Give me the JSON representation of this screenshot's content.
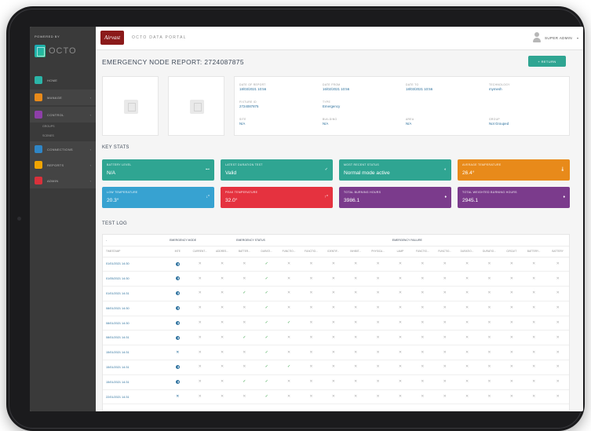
{
  "sidebar": {
    "powered_by": "POWERED BY",
    "logo_text": "OCTO",
    "items": [
      {
        "label": "HOME",
        "icon": "home-icon",
        "color": "#2bb5a8",
        "caret": ""
      },
      {
        "label": "MANAGE",
        "icon": "manage-icon",
        "color": "#e88a1a",
        "caret": "‹"
      },
      {
        "label": "CONTROL",
        "icon": "control-icon",
        "color": "#8e3fa8",
        "caret": "‹"
      },
      {
        "label": "CONNECTIONS",
        "icon": "connections-icon",
        "color": "#2f86c6",
        "caret": "‹"
      },
      {
        "label": "REPORTS",
        "icon": "reports-icon",
        "color": "#f0a400",
        "caret": "‹"
      },
      {
        "label": "ADMIN",
        "icon": "admin-icon",
        "color": "#d9313b",
        "caret": "‹"
      }
    ],
    "sub_items": [
      "GROUPS",
      "SCENES"
    ]
  },
  "topbar": {
    "logo_text": "Airvast",
    "portal_title": "OCTO DATA PORTAL",
    "user": "SUPER ADMIN",
    "caret": "▾"
  },
  "page": {
    "title": "EMERGENCY NODE REPORT: 2724087875",
    "return_label": "+ RETURN"
  },
  "info": {
    "date_of_report": {
      "label": "DATE OF REPORT",
      "value": "18/03/2021 10:56"
    },
    "date_from": {
      "label": "DATE FROM",
      "value": "16/02/2021 10:56"
    },
    "date_to": {
      "label": "DATE TO",
      "value": "18/03/2021 10:56"
    },
    "technology": {
      "label": "TECHNOLOGY",
      "value": "mymesh"
    },
    "fixture_id": {
      "label": "FIXTURE ID",
      "value": "2724087875"
    },
    "type": {
      "label": "TYPE",
      "value": "Emergency"
    },
    "site": {
      "label": "SITE",
      "value": "N/A"
    },
    "building": {
      "label": "BUILDING",
      "value": "N/A"
    },
    "area": {
      "label": "AREA",
      "value": "N/A"
    },
    "group": {
      "label": "GROUP",
      "value": "Not Grouped"
    }
  },
  "key_stats": {
    "title": "KEY STATS",
    "cards": [
      {
        "label": "BATTERY LEVEL",
        "value": "N/A",
        "color": "#2fa592",
        "icon": "⊷"
      },
      {
        "label": "LATEST DURATION TEST",
        "value": "Valid",
        "color": "#2fa592",
        "icon": "✓"
      },
      {
        "label": "MOST RECENT STATUS",
        "value": "Normal mode active",
        "color": "#2fa592",
        "icon": "◐"
      },
      {
        "label": "AVERAGE TEMPERATURE",
        "value": "26.4°",
        "color": "#e88a1a",
        "icon": "🌡"
      },
      {
        "label": "LOW TEMPERATURE",
        "value": "20.3°",
        "color": "#37a2d1",
        "icon": "↓°"
      },
      {
        "label": "PEAK TEMPERATURE",
        "value": "32.0°",
        "color": "#e5323f",
        "icon": "↑°"
      },
      {
        "label": "TOTAL BURNING HOURS",
        "value": "3986.1",
        "color": "#7b3b8c",
        "icon": "♦"
      },
      {
        "label": "TOTAL WEIGHTED BURNING HOURS",
        "value": "2945.1",
        "color": "#7b3b8c",
        "icon": "♦"
      }
    ]
  },
  "test_log": {
    "title": "TEST LOG",
    "groups": [
      "EMERGENCY MODE",
      "EMERGENCY STATUS",
      "EMERGENCY FAILURE"
    ],
    "columns": [
      "TIMESTAMP",
      "INTE",
      "CURRENT...",
      "ADDRES...",
      "BATTER...",
      "DURATI...",
      "FUNCTIO...",
      "FUNCTIO...",
      "IDENTIF...",
      "INHIBIT...",
      "PHYSICA...",
      "LAMP",
      "FUNCTIO...",
      "FUNCTIO...",
      "DURATIO...",
      "DURATIO...",
      "CIRCUIT",
      "BATTERY...",
      "BATTERY"
    ],
    "rows": [
      {
        "ts": "01/01/2021 14:30",
        "cells": [
          "H",
          "X",
          "X",
          "X",
          "V",
          "X",
          "X",
          "X",
          "X",
          "X",
          "X",
          "X",
          "X",
          "X",
          "X",
          "X",
          "X",
          "X"
        ]
      },
      {
        "ts": "01/05/2021 14:30",
        "cells": [
          "H",
          "X",
          "X",
          "X",
          "V",
          "X",
          "X",
          "X",
          "X",
          "X",
          "X",
          "X",
          "X",
          "X",
          "X",
          "X",
          "X",
          "X"
        ]
      },
      {
        "ts": "01/01/2021 14:31",
        "cells": [
          "H",
          "X",
          "X",
          "V",
          "V",
          "X",
          "X",
          "X",
          "X",
          "X",
          "X",
          "X",
          "X",
          "X",
          "X",
          "X",
          "X",
          "X"
        ]
      },
      {
        "ts": "08/01/2021 14:30",
        "cells": [
          "H",
          "X",
          "X",
          "X",
          "V",
          "X",
          "X",
          "X",
          "X",
          "X",
          "X",
          "X",
          "X",
          "X",
          "X",
          "X",
          "X",
          "X"
        ]
      },
      {
        "ts": "08/01/2021 14:30",
        "cells": [
          "H",
          "X",
          "X",
          "X",
          "V",
          "V",
          "X",
          "X",
          "X",
          "X",
          "X",
          "X",
          "X",
          "X",
          "X",
          "X",
          "X",
          "X"
        ]
      },
      {
        "ts": "08/01/2021 14:31",
        "cells": [
          "H",
          "X",
          "X",
          "V",
          "V",
          "X",
          "X",
          "X",
          "X",
          "X",
          "X",
          "X",
          "X",
          "X",
          "X",
          "X",
          "X",
          "X"
        ]
      },
      {
        "ts": "15/01/2021 14:31",
        "cells": [
          "B",
          "X",
          "X",
          "X",
          "V",
          "X",
          "X",
          "X",
          "X",
          "X",
          "X",
          "X",
          "X",
          "X",
          "X",
          "X",
          "X",
          "X"
        ]
      },
      {
        "ts": "15/01/2021 14:31",
        "cells": [
          "H",
          "X",
          "X",
          "X",
          "V",
          "V",
          "X",
          "X",
          "X",
          "X",
          "X",
          "X",
          "X",
          "X",
          "X",
          "X",
          "X",
          "X"
        ]
      },
      {
        "ts": "15/01/2021 14:31",
        "cells": [
          "H",
          "X",
          "X",
          "V",
          "V",
          "X",
          "X",
          "X",
          "X",
          "X",
          "X",
          "X",
          "X",
          "X",
          "X",
          "X",
          "X",
          "X"
        ]
      },
      {
        "ts": "22/01/2021 14:31",
        "cells": [
          "B",
          "X",
          "X",
          "X",
          "V",
          "X",
          "X",
          "X",
          "X",
          "X",
          "X",
          "X",
          "X",
          "X",
          "X",
          "X",
          "X",
          "X"
        ]
      }
    ]
  },
  "colors": {
    "sidebar_bg": "#3a3a3a",
    "accent_teal": "#2fa592",
    "link_blue": "#2a6f9c",
    "ok_green": "#3aa34a"
  }
}
